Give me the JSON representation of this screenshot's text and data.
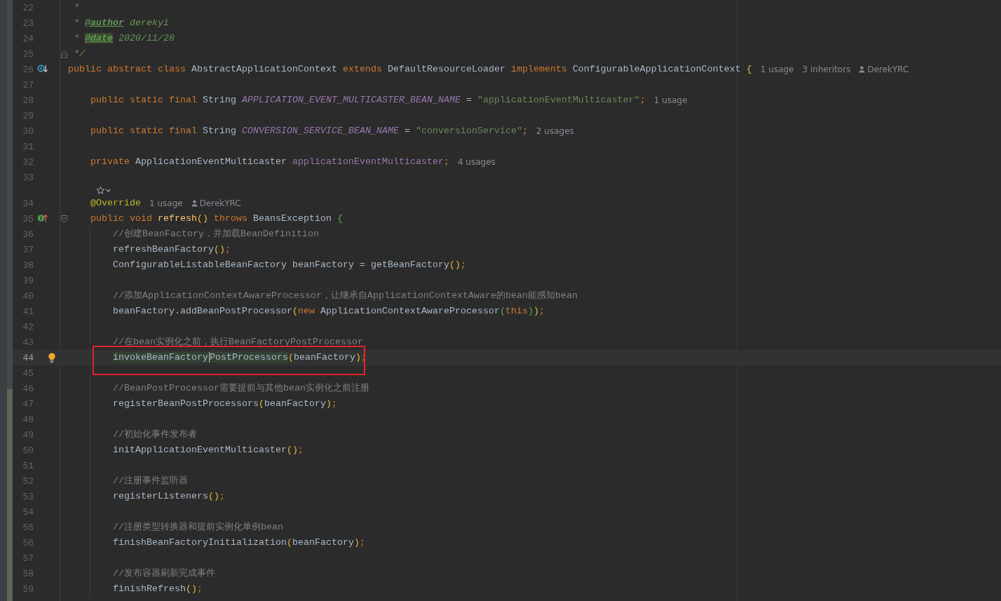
{
  "editor": {
    "lines": [
      {
        "kind": "doc-body",
        "number": "22",
        "current": false,
        "tokens": [
          {
            "kind": "doc",
            "text": "*"
          }
        ]
      },
      {
        "kind": "doc-body",
        "number": "23",
        "current": false,
        "tokens": [
          {
            "kind": "doc",
            "text": "* "
          },
          {
            "kind": "doc-tag",
            "text": "@author"
          },
          {
            "kind": "doc",
            "text": " derekyi"
          }
        ]
      },
      {
        "kind": "doc-body",
        "number": "24",
        "current": false,
        "tokens": [
          {
            "kind": "doc",
            "text": "* "
          },
          {
            "kind": "doc-tag-match",
            "text": "@date"
          },
          {
            "kind": "doc",
            "text": " 2020/11/28"
          }
        ]
      },
      {
        "kind": "doc-body",
        "number": "25",
        "current": false,
        "fold": {
          "kind": "end"
        },
        "tokens": [
          {
            "kind": "doc",
            "text": "*/"
          }
        ]
      },
      {
        "kind": "code",
        "number": "26",
        "current": false,
        "gutter_icon": {
          "kind": "implemented"
        },
        "tokens": [
          {
            "kind": "keyword",
            "text": "public abstract class "
          },
          {
            "kind": "type",
            "text": "AbstractApplicationContext "
          },
          {
            "kind": "keyword",
            "text": "extends "
          },
          {
            "kind": "type",
            "text": "DefaultResourceLoader "
          },
          {
            "kind": "keyword",
            "text": "implements "
          },
          {
            "kind": "type",
            "text": "ConfigurableApplicationContext "
          },
          {
            "kind": "bracket1",
            "text": "{"
          }
        ],
        "hints": [
          {
            "kind": "usage",
            "text": "1 usage"
          },
          {
            "kind": "usage",
            "text": "3 inheritors"
          },
          {
            "kind": "author",
            "text": "DerekYRC"
          }
        ],
        "children": [
          {
            "kind": "code",
            "number": "27",
            "current": false
          },
          {
            "kind": "code",
            "number": "28",
            "current": false,
            "tokens": [
              {
                "kind": "keyword",
                "text": "public static final "
              },
              {
                "kind": "type",
                "text": "String "
              },
              {
                "kind": "constant",
                "text": "APPLICATION_EVENT_MULTICASTER_BEAN_NAME"
              },
              {
                "kind": "plain",
                "text": " = "
              },
              {
                "kind": "string",
                "text": "\"applicationEventMulticaster\""
              },
              {
                "kind": "semicolon",
                "text": ";"
              }
            ],
            "hints": [
              {
                "kind": "usage",
                "text": "1 usage"
              }
            ]
          },
          {
            "kind": "code",
            "number": "29",
            "current": false
          },
          {
            "kind": "code",
            "number": "30",
            "current": false,
            "tokens": [
              {
                "kind": "keyword",
                "text": "public static final "
              },
              {
                "kind": "type",
                "text": "String "
              },
              {
                "kind": "constant",
                "text": "CONVERSION_SERVICE_BEAN_NAME"
              },
              {
                "kind": "plain",
                "text": " = "
              },
              {
                "kind": "string",
                "text": "\"conversionService\""
              },
              {
                "kind": "semicolon",
                "text": ";"
              }
            ],
            "hints": [
              {
                "kind": "usage",
                "text": "2 usages"
              }
            ]
          },
          {
            "kind": "code",
            "number": "31",
            "current": false
          },
          {
            "kind": "code",
            "number": "32",
            "current": false,
            "tokens": [
              {
                "kind": "keyword",
                "text": "private "
              },
              {
                "kind": "type",
                "text": "ApplicationEventMulticaster "
              },
              {
                "kind": "field",
                "text": "applicationEventMulticaster"
              },
              {
                "kind": "semicolon",
                "text": ";"
              }
            ],
            "hints": [
              {
                "kind": "usage",
                "text": "4 usages"
              }
            ]
          },
          {
            "kind": "code",
            "number": "33",
            "current": false
          },
          {
            "kind": "vision"
          },
          {
            "kind": "code",
            "number": "34",
            "current": false,
            "tokens": [
              {
                "kind": "annotation",
                "text": "@Override"
              }
            ],
            "hints": [
              {
                "kind": "usage",
                "text": "1 usage"
              },
              {
                "kind": "author",
                "text": "DerekYRC"
              }
            ]
          },
          {
            "kind": "code",
            "number": "35",
            "current": false,
            "gutter_icon": {
              "kind": "overrides"
            },
            "fold": {
              "kind": "start"
            },
            "tokens": [
              {
                "kind": "keyword",
                "text": "public void "
              },
              {
                "kind": "method",
                "text": "refresh"
              },
              {
                "kind": "bracket1",
                "text": "()"
              },
              {
                "kind": "keyword",
                "text": " throws "
              },
              {
                "kind": "type",
                "text": "BeansException "
              },
              {
                "kind": "bracket2",
                "text": "{"
              }
            ],
            "children": [
              {
                "kind": "code",
                "number": "36",
                "current": false,
                "tokens": [
                  {
                    "kind": "comment",
                    "text": "//创建BeanFactory，并加载BeanDefinition"
                  }
                ]
              },
              {
                "kind": "code",
                "number": "37",
                "current": false,
                "tokens": [
                  {
                    "kind": "plain",
                    "text": "refreshBeanFactory"
                  },
                  {
                    "kind": "bracket1",
                    "text": "()"
                  },
                  {
                    "kind": "semicolon",
                    "text": ";"
                  }
                ]
              },
              {
                "kind": "code",
                "number": "38",
                "current": false,
                "tokens": [
                  {
                    "kind": "plain",
                    "text": "ConfigurableListableBeanFactory beanFactory = getBeanFactory"
                  },
                  {
                    "kind": "bracket1",
                    "text": "()"
                  },
                  {
                    "kind": "semicolon",
                    "text": ";"
                  }
                ]
              },
              {
                "kind": "code",
                "number": "39",
                "current": false
              },
              {
                "kind": "code",
                "number": "40",
                "current": false,
                "tokens": [
                  {
                    "kind": "comment",
                    "text": "//添加ApplicationContextAwareProcessor，让继承自ApplicationContextAware的bean能感知bean"
                  }
                ]
              },
              {
                "kind": "code",
                "number": "41",
                "current": false,
                "tokens": [
                  {
                    "kind": "plain",
                    "text": "beanFactory.addBeanPostProcessor"
                  },
                  {
                    "kind": "bracket1",
                    "text": "("
                  },
                  {
                    "kind": "keyword",
                    "text": "new "
                  },
                  {
                    "kind": "plain",
                    "text": "ApplicationContextAwareProcessor"
                  },
                  {
                    "kind": "bracket2",
                    "text": "("
                  },
                  {
                    "kind": "keyword",
                    "text": "this"
                  },
                  {
                    "kind": "bracket2",
                    "text": ")"
                  },
                  {
                    "kind": "bracket1",
                    "text": ")"
                  },
                  {
                    "kind": "semicolon",
                    "text": ";"
                  }
                ]
              },
              {
                "kind": "code",
                "number": "42",
                "current": false
              },
              {
                "kind": "code",
                "number": "43",
                "current": false,
                "tokens": [
                  {
                    "kind": "comment",
                    "text": "//在bean实例化之前，执行BeanFactoryPostProcessor"
                  }
                ]
              },
              {
                "kind": "code",
                "number": "44",
                "current": true,
                "gutter_icon": {
                  "kind": "bulb"
                },
                "tokens": [
                  {
                    "kind": "usage",
                    "text": "invokeBeanFactory"
                  },
                  {
                    "kind": "usage-caret",
                    "text": "PostProcessors"
                  },
                  {
                    "kind": "bracket1",
                    "text": "("
                  },
                  {
                    "kind": "plain",
                    "text": "beanFactory"
                  },
                  {
                    "kind": "bracket1",
                    "text": ")"
                  },
                  {
                    "kind": "semicolon",
                    "text": ";"
                  }
                ]
              },
              {
                "kind": "code",
                "number": "45",
                "current": false
              },
              {
                "kind": "code",
                "number": "46",
                "current": false,
                "tokens": [
                  {
                    "kind": "comment",
                    "text": "//BeanPostProcessor需要提前与其他bean实例化之前注册"
                  }
                ]
              },
              {
                "kind": "code",
                "number": "47",
                "current": false,
                "tokens": [
                  {
                    "kind": "plain",
                    "text": "registerBeanPostProcessors"
                  },
                  {
                    "kind": "bracket1",
                    "text": "("
                  },
                  {
                    "kind": "plain",
                    "text": "beanFactory"
                  },
                  {
                    "kind": "bracket1",
                    "text": ")"
                  },
                  {
                    "kind": "semicolon",
                    "text": ";"
                  }
                ]
              },
              {
                "kind": "code",
                "number": "48",
                "current": false
              },
              {
                "kind": "code",
                "number": "49",
                "current": false,
                "tokens": [
                  {
                    "kind": "comment",
                    "text": "//初始化事件发布者"
                  }
                ]
              },
              {
                "kind": "code",
                "number": "50",
                "current": false,
                "tokens": [
                  {
                    "kind": "plain",
                    "text": "initApplicationEventMulticaster"
                  },
                  {
                    "kind": "bracket1",
                    "text": "()"
                  },
                  {
                    "kind": "semicolon",
                    "text": ";"
                  }
                ]
              },
              {
                "kind": "code",
                "number": "51",
                "current": false
              },
              {
                "kind": "code",
                "number": "52",
                "current": false,
                "tokens": [
                  {
                    "kind": "comment",
                    "text": "//注册事件监听器"
                  }
                ]
              },
              {
                "kind": "code",
                "number": "53",
                "current": false,
                "tokens": [
                  {
                    "kind": "plain",
                    "text": "registerListeners"
                  },
                  {
                    "kind": "bracket1",
                    "text": "()"
                  },
                  {
                    "kind": "semicolon",
                    "text": ";"
                  }
                ]
              },
              {
                "kind": "code",
                "number": "54",
                "current": false
              },
              {
                "kind": "code",
                "number": "55",
                "current": false,
                "tokens": [
                  {
                    "kind": "comment",
                    "text": "//注册类型转换器和提前实例化单例bean"
                  }
                ]
              },
              {
                "kind": "code",
                "number": "56",
                "current": false,
                "tokens": [
                  {
                    "kind": "plain",
                    "text": "finishBeanFactoryInitialization"
                  },
                  {
                    "kind": "bracket1",
                    "text": "("
                  },
                  {
                    "kind": "plain",
                    "text": "beanFactory"
                  },
                  {
                    "kind": "bracket1",
                    "text": ")"
                  },
                  {
                    "kind": "semicolon",
                    "text": ";"
                  }
                ]
              },
              {
                "kind": "code",
                "number": "57",
                "current": false
              },
              {
                "kind": "code",
                "number": "58",
                "current": false,
                "tokens": [
                  {
                    "kind": "comment",
                    "text": "//发布容器刷新完成事件"
                  }
                ]
              },
              {
                "kind": "code",
                "number": "59",
                "current": false,
                "tokens": [
                  {
                    "kind": "plain",
                    "text": "finishRefresh"
                  },
                  {
                    "kind": "bracket1",
                    "text": "()"
                  },
                  {
                    "kind": "semicolon",
                    "text": ";"
                  }
                ]
              }
            ]
          }
        ]
      }
    ]
  }
}
